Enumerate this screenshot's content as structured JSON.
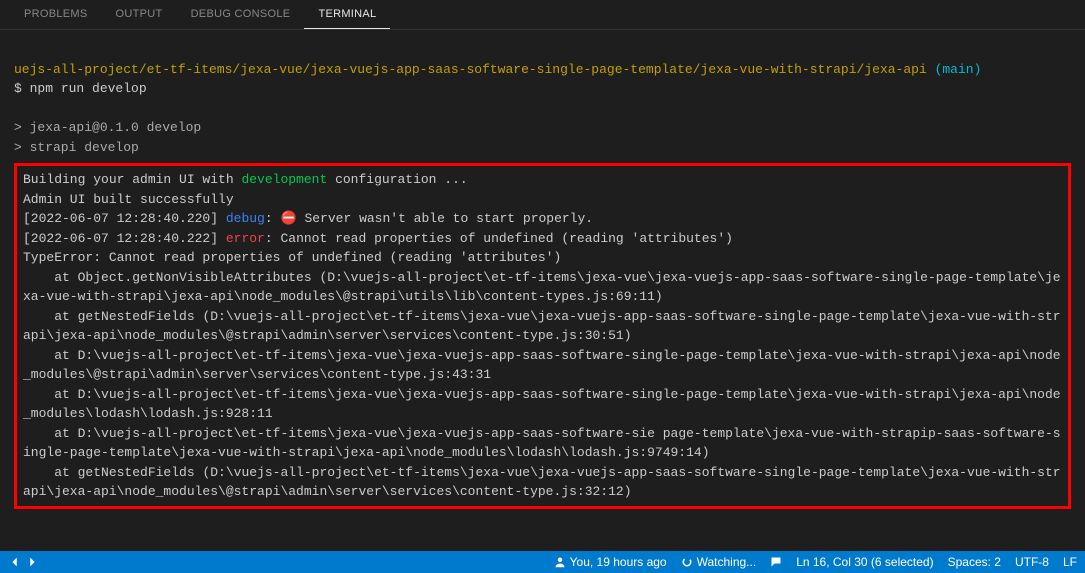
{
  "tabs": {
    "problems": "PROBLEMS",
    "output": "OUTPUT",
    "debug_console": "DEBUG CONSOLE",
    "terminal": "TERMINAL"
  },
  "terminal": {
    "path": "uejs-all-project/et-tf-items/jexa-vue/jexa-vuejs-app-saas-software-single-page-template/jexa-vue-with-strapi/jexa-api",
    "branch": "(main)",
    "prompt": "$ ",
    "command": "npm run develop",
    "script_line1": "> jexa-api@0.1.0 develop",
    "script_line2": "> strapi develop",
    "build_prefix": "Building your admin UI with ",
    "build_mode": "development",
    "build_suffix": " configuration ...",
    "built_ok": "Admin UI built successfully",
    "ts1_bracket": "[2022-06-07 12:28:40.220] ",
    "debug_label": "debug",
    "debug_colon": ": ",
    "stop": "⛔",
    "debug_msg": " Server wasn't able to start properly.",
    "ts2_bracket": "[2022-06-07 12:28:40.222] ",
    "error_label": "error",
    "error_colon": ": ",
    "error_msg": "Cannot read properties of undefined (reading 'attributes')",
    "type_error": "TypeError: Cannot read properties of undefined (reading 'attributes')",
    "stack1": "    at Object.getNonVisibleAttributes (D:\\vuejs-all-project\\et-tf-items\\jexa-vue\\jexa-vuejs-app-saas-software-single-page-template\\jexa-vue-with-strapi\\jexa-api\\node_modules\\@strapi\\utils\\lib\\content-types.js:69:11)",
    "stack2": "    at getNestedFields (D:\\vuejs-all-project\\et-tf-items\\jexa-vue\\jexa-vuejs-app-saas-software-single-page-template\\jexa-vue-with-strapi\\jexa-api\\node_modules\\@strapi\\admin\\server\\services\\content-type.js:30:51)",
    "stack3": "    at D:\\vuejs-all-project\\et-tf-items\\jexa-vue\\jexa-vuejs-app-saas-software-single-page-template\\jexa-vue-with-strapi\\jexa-api\\node_modules\\@strapi\\admin\\server\\services\\content-type.js:43:31",
    "stack4": "    at D:\\vuejs-all-project\\et-tf-items\\jexa-vue\\jexa-vuejs-app-saas-software-single-page-template\\jexa-vue-with-strapi\\jexa-api\\node_modules\\lodash\\lodash.js:928:11",
    "stack5": "    at D:\\vuejs-all-project\\et-tf-items\\jexa-vue\\jexa-vuejs-app-saas-software-sie page-template\\jexa-vue-with-strapip-saas-software-single-page-template\\jexa-vue-with-strapi\\jexa-api\\node_modules\\lodash\\lodash.js:9749:14)",
    "stack6": "    at getNestedFields (D:\\vuejs-all-project\\et-tf-items\\jexa-vue\\jexa-vuejs-app-saas-software-single-page-template\\jexa-vue-with-strapi\\jexa-api\\node_modules\\@strapi\\admin\\server\\services\\content-type.js:32:12)"
  },
  "statusbar": {
    "blame": "You, 19 hours ago",
    "watching": "Watching...",
    "cursor": "Ln 16, Col 30 (6 selected)",
    "spaces": "Spaces: 2",
    "encoding": "UTF-8",
    "eol": "LF"
  }
}
